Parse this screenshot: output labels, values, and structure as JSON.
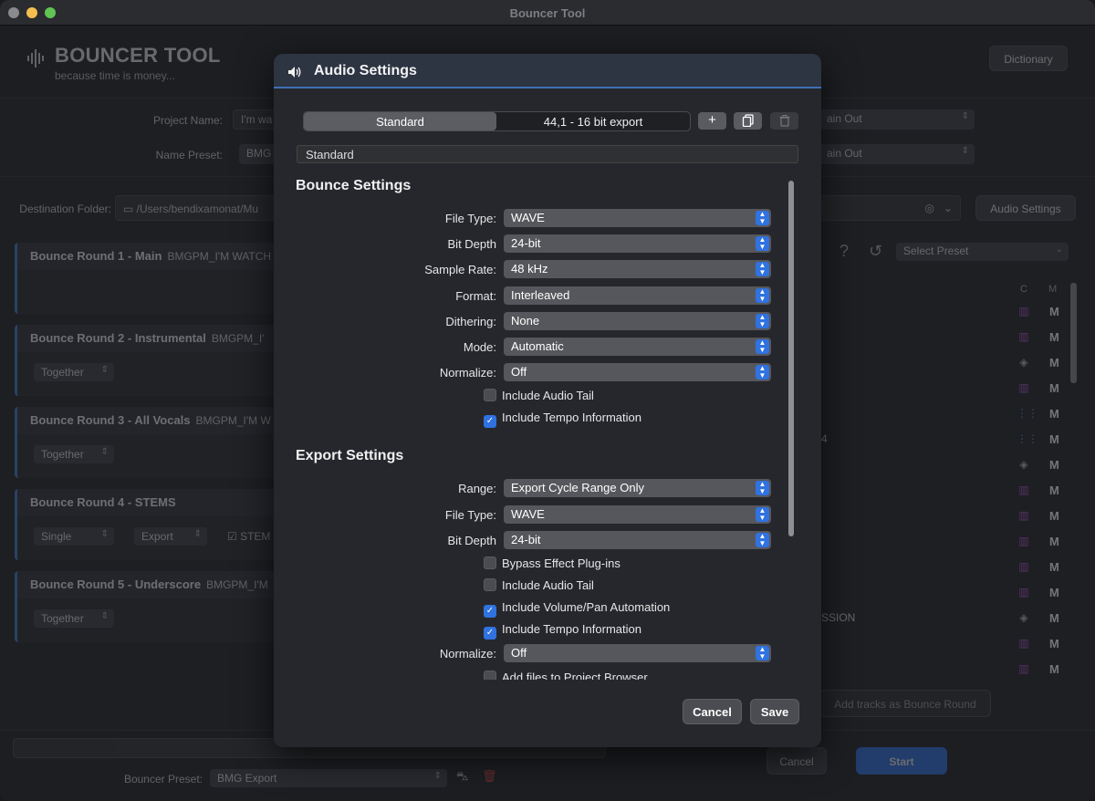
{
  "window": {
    "title": "Bouncer Tool"
  },
  "app": {
    "title": "BOUNCER TOOL",
    "subtitle": "because time is money...",
    "dictionary_button": "Dictionary",
    "project_name_label": "Project Name:",
    "project_name_value": "I'm wa",
    "name_preset_label": "Name Preset:",
    "name_preset_value": "BMG",
    "main_out_1": "ain Out",
    "main_out_2": "ain Out",
    "destination_label": "Destination Folder:",
    "destination_value": "/Users/bendixamonat/Mu",
    "audio_settings_button": "Audio Settings",
    "select_preset": "Select Preset",
    "col_c": "C",
    "col_m": "M",
    "rounds": [
      {
        "title": "Bounce Round 1 - Main",
        "filename": "BMGPM_I'M WATCH",
        "opt1": "",
        "opt2": ""
      },
      {
        "title": "Bounce Round 2 - Instrumental",
        "filename": "BMGPM_I'",
        "opt1": "Together"
      },
      {
        "title": "Bounce Round 3 - All Vocals",
        "filename": "BMGPM_I'M W",
        "opt1": "Together"
      },
      {
        "title": "Bounce Round 4 - STEMS",
        "filename": "",
        "opt1": "Single",
        "opt2": "Export",
        "opt3": "STEM"
      },
      {
        "title": "Bounce Round 5 - Underscore",
        "filename": "BMGPM_I'M",
        "opt1": "Together"
      }
    ],
    "track_fragment_4": "4",
    "track_fragment_ssion": "SSION",
    "add_tracks_button": "Add tracks as Bounce Round",
    "bouncer_preset_label": "Bouncer Preset:",
    "bouncer_preset_value": "BMG Export",
    "cancel_button": "Cancel",
    "start_button": "Start"
  },
  "dialog": {
    "title": "Audio Settings",
    "segment_a": "Standard",
    "segment_b": "44,1 - 16 bit export",
    "add_icon": "plus-icon",
    "duplicate_icon": "duplicate-icon",
    "trash_icon": "trash-icon",
    "preset_name": "Standard",
    "bounce_section": "Bounce Settings",
    "bounce_rows": [
      {
        "label": "File Type:",
        "value": "WAVE"
      },
      {
        "label": "Bit Depth",
        "value": "24-bit"
      },
      {
        "label": "Sample Rate:",
        "value": "48 kHz"
      },
      {
        "label": "Format:",
        "value": "Interleaved"
      },
      {
        "label": "Dithering:",
        "value": "None"
      },
      {
        "label": "Mode:",
        "value": "Automatic"
      },
      {
        "label": "Normalize:",
        "value": "Off"
      }
    ],
    "bounce_checks": [
      {
        "label": "Include Audio Tail",
        "checked": false
      },
      {
        "label": "Include Tempo Information",
        "checked": true
      }
    ],
    "export_section": "Export Settings",
    "export_rows": [
      {
        "label": "Range:",
        "value": "Export Cycle Range Only"
      },
      {
        "label": "File Type:",
        "value": "WAVE"
      },
      {
        "label": "Bit Depth",
        "value": "24-bit"
      }
    ],
    "export_checks": [
      {
        "label": "Bypass Effect Plug-ins",
        "checked": false
      },
      {
        "label": "Include Audio Tail",
        "checked": false
      },
      {
        "label": "Include Volume/Pan Automation",
        "checked": true
      },
      {
        "label": "Include Tempo Information",
        "checked": true
      }
    ],
    "export_normalize": {
      "label": "Normalize:",
      "value": "Off"
    },
    "export_last_check": {
      "label": "Add files to Project Browser",
      "checked": false
    },
    "cancel_button": "Cancel",
    "save_button": "Save"
  },
  "colors": {
    "accent": "#2f72e0",
    "purple": "#b04fd0",
    "blue": "#4f8fe0"
  }
}
